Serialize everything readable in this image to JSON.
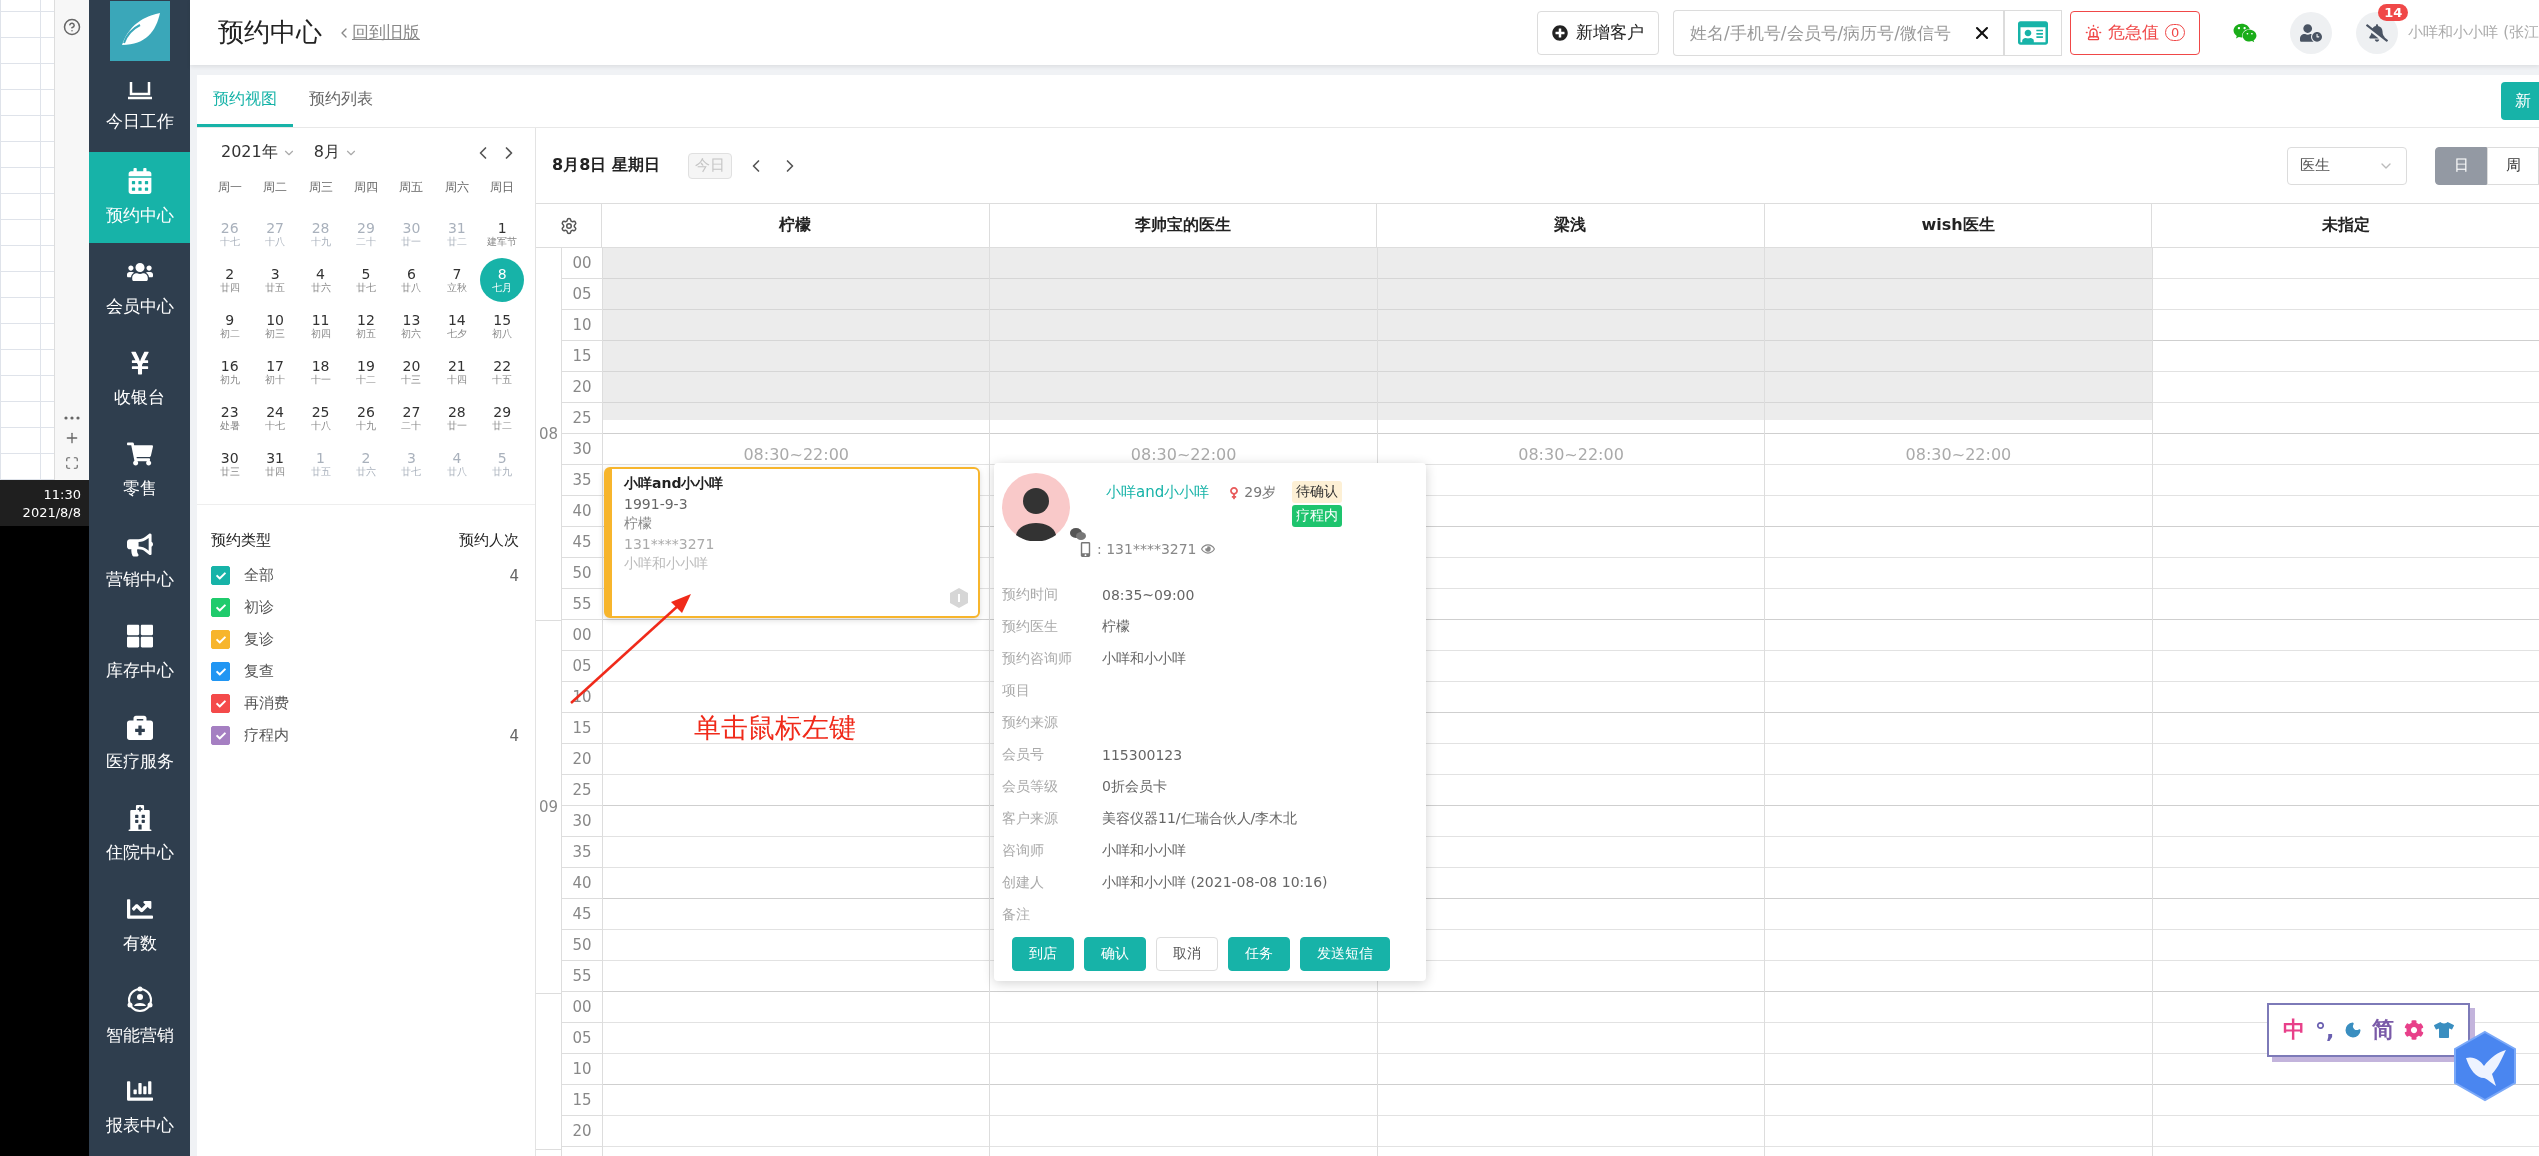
{
  "side_app": {
    "time": "11:30",
    "date": "2021/8/8"
  },
  "nav": {
    "items": [
      {
        "label": "今日工作",
        "selected": false
      },
      {
        "label": "预约中心",
        "selected": true
      },
      {
        "label": "会员中心",
        "selected": false
      },
      {
        "label": "收银台",
        "selected": false
      },
      {
        "label": "零售",
        "selected": false
      },
      {
        "label": "营销中心",
        "selected": false
      },
      {
        "label": "库存中心",
        "selected": false
      },
      {
        "label": "医疗服务",
        "selected": false
      },
      {
        "label": "住院中心",
        "selected": false
      },
      {
        "label": "有数",
        "selected": false
      },
      {
        "label": "智能营销",
        "selected": false
      },
      {
        "label": "报表中心",
        "selected": false
      }
    ]
  },
  "header": {
    "title": "预约中心",
    "back_link": "回到旧版",
    "add_customer": "新增客户",
    "search": {
      "placeholder": "姓名/手机号/会员号/病历号/微信号"
    },
    "alert": {
      "label": "危急值",
      "count": "0"
    },
    "notification_count": "14",
    "user": "小咩和小小咩 (张江"
  },
  "tabs": [
    {
      "label": "预约视图",
      "selected": true
    },
    {
      "label": "预约列表",
      "selected": false
    }
  ],
  "new_button": "新",
  "calendar": {
    "year": "2021年",
    "month": "8月",
    "weekdays": [
      "周一",
      "周二",
      "周三",
      "周四",
      "周五",
      "周六",
      "周日"
    ],
    "days": [
      {
        "day": "26",
        "lunar": "十七",
        "outside": true,
        "selected": false
      },
      {
        "day": "27",
        "lunar": "十八",
        "outside": true,
        "selected": false
      },
      {
        "day": "28",
        "lunar": "十九",
        "outside": true,
        "selected": false
      },
      {
        "day": "29",
        "lunar": "二十",
        "outside": true,
        "selected": false
      },
      {
        "day": "30",
        "lunar": "廿一",
        "outside": true,
        "selected": false
      },
      {
        "day": "31",
        "lunar": "廿二",
        "outside": true,
        "selected": false
      },
      {
        "day": "1",
        "lunar": "建军节",
        "outside": false,
        "selected": false
      },
      {
        "day": "2",
        "lunar": "廿四",
        "outside": false,
        "selected": false
      },
      {
        "day": "3",
        "lunar": "廿五",
        "outside": false,
        "selected": false
      },
      {
        "day": "4",
        "lunar": "廿六",
        "outside": false,
        "selected": false
      },
      {
        "day": "5",
        "lunar": "廿七",
        "outside": false,
        "selected": false
      },
      {
        "day": "6",
        "lunar": "廿八",
        "outside": false,
        "selected": false
      },
      {
        "day": "7",
        "lunar": "立秋",
        "outside": false,
        "selected": false
      },
      {
        "day": "8",
        "lunar": "七月",
        "outside": false,
        "selected": true
      },
      {
        "day": "9",
        "lunar": "初二",
        "outside": false,
        "selected": false
      },
      {
        "day": "10",
        "lunar": "初三",
        "outside": false,
        "selected": false
      },
      {
        "day": "11",
        "lunar": "初四",
        "outside": false,
        "selected": false
      },
      {
        "day": "12",
        "lunar": "初五",
        "outside": false,
        "selected": false
      },
      {
        "day": "13",
        "lunar": "初六",
        "outside": false,
        "selected": false
      },
      {
        "day": "14",
        "lunar": "七夕",
        "outside": false,
        "selected": false
      },
      {
        "day": "15",
        "lunar": "初八",
        "outside": false,
        "selected": false
      },
      {
        "day": "16",
        "lunar": "初九",
        "outside": false,
        "selected": false
      },
      {
        "day": "17",
        "lunar": "初十",
        "outside": false,
        "selected": false
      },
      {
        "day": "18",
        "lunar": "十一",
        "outside": false,
        "selected": false
      },
      {
        "day": "19",
        "lunar": "十二",
        "outside": false,
        "selected": false
      },
      {
        "day": "20",
        "lunar": "十三",
        "outside": false,
        "selected": false
      },
      {
        "day": "21",
        "lunar": "十四",
        "outside": false,
        "selected": false
      },
      {
        "day": "22",
        "lunar": "十五",
        "outside": false,
        "selected": false
      },
      {
        "day": "23",
        "lunar": "处暑",
        "outside": false,
        "selected": false
      },
      {
        "day": "24",
        "lunar": "十七",
        "outside": false,
        "selected": false
      },
      {
        "day": "25",
        "lunar": "十八",
        "outside": false,
        "selected": false
      },
      {
        "day": "26",
        "lunar": "十九",
        "outside": false,
        "selected": false
      },
      {
        "day": "27",
        "lunar": "二十",
        "outside": false,
        "selected": false
      },
      {
        "day": "28",
        "lunar": "廿一",
        "outside": false,
        "selected": false
      },
      {
        "day": "29",
        "lunar": "廿二",
        "outside": false,
        "selected": false
      },
      {
        "day": "30",
        "lunar": "廿三",
        "outside": false,
        "selected": false
      },
      {
        "day": "31",
        "lunar": "廿四",
        "outside": false,
        "selected": false
      },
      {
        "day": "1",
        "lunar": "廿五",
        "outside": true,
        "selected": false
      },
      {
        "day": "2",
        "lunar": "廿六",
        "outside": true,
        "selected": false
      },
      {
        "day": "3",
        "lunar": "廿七",
        "outside": true,
        "selected": false
      },
      {
        "day": "4",
        "lunar": "廿八",
        "outside": true,
        "selected": false
      },
      {
        "day": "5",
        "lunar": "廿九",
        "outside": true,
        "selected": false
      }
    ]
  },
  "types": {
    "title": "预约类型",
    "count_title": "预约人次",
    "items": [
      {
        "label": "全部",
        "color": "#17b3a8",
        "checked": true,
        "count": "4"
      },
      {
        "label": "初诊",
        "color": "#1fcb6c",
        "checked": true
      },
      {
        "label": "复诊",
        "color": "#f7b52c",
        "checked": true
      },
      {
        "label": "复查",
        "color": "#2196f3",
        "checked": true
      },
      {
        "label": "再消费",
        "color": "#f44a4a",
        "checked": true
      },
      {
        "label": "疗程内",
        "color": "#a57fc2",
        "checked": true,
        "count": "4"
      }
    ]
  },
  "schedule": {
    "date": "8月8日 星期日",
    "today": "今日",
    "view_select": "医生",
    "views": [
      {
        "label": "日",
        "selected": true
      },
      {
        "label": "周",
        "selected": false
      }
    ],
    "columns": [
      {
        "name": "柠檬",
        "closed": true,
        "hours": "08:30~22:00"
      },
      {
        "name": "李帅宝的医生",
        "closed": true,
        "hours": "08:30~22:00"
      },
      {
        "name": "梁浅",
        "closed": true,
        "hours": "08:30~22:00"
      },
      {
        "name": "wish医生",
        "closed": true,
        "hours": "08:30~22:00"
      },
      {
        "name": "未指定",
        "closed": false
      }
    ],
    "hours": [
      {
        "hour": "08",
        "minutes": [
          "00",
          "05",
          "10",
          "15",
          "20",
          "25",
          "30",
          "35",
          "40",
          "45",
          "50",
          "55"
        ]
      },
      {
        "hour": "09",
        "minutes": [
          "00",
          "05",
          "10",
          "15",
          "20",
          "25",
          "30",
          "35",
          "40",
          "45",
          "50",
          "55"
        ]
      },
      {
        "minutes": [
          "00",
          "05",
          "10",
          "15",
          "20"
        ]
      }
    ]
  },
  "appointment": {
    "color": "#f7b52c",
    "name": "小咩and小小咩",
    "birthday": "1991-9-3",
    "doctor": "柠檬",
    "phone": "131****3271",
    "consultant": "小咩和小小咩"
  },
  "popup": {
    "name": "小咩and小小咩",
    "age": "29岁",
    "tags": [
      {
        "label": "待确认",
        "kind": "pending"
      },
      {
        "label": "疗程内",
        "kind": "course"
      }
    ],
    "phone": ": 131****3271",
    "fields": [
      {
        "label": "预约时间",
        "value": "08:35~09:00"
      },
      {
        "label": "预约医生",
        "value": "柠檬"
      },
      {
        "label": "预约咨询师",
        "value": "小咩和小小咩"
      },
      {
        "label": "项目"
      },
      {
        "label": "预约来源"
      },
      {
        "label": "会员号",
        "value": "115300123"
      },
      {
        "label": "会员等级",
        "value": "0折会员卡"
      },
      {
        "label": "客户来源",
        "value": "美容仪器11/仁瑞合伙人/李木北"
      },
      {
        "label": "咨询师",
        "value": "小咩和小小咩"
      },
      {
        "label": "创建人",
        "value": "小咩和小小咩 (2021-08-08 10:16)"
      },
      {
        "label": "备注"
      }
    ],
    "actions": [
      {
        "label": "到店",
        "kind": "primary"
      },
      {
        "label": "确认",
        "kind": "primary"
      },
      {
        "label": "取消",
        "kind": "default"
      },
      {
        "label": "任务",
        "kind": "primary"
      },
      {
        "label": "发送短信",
        "kind": "primary"
      }
    ]
  },
  "annotation": "单击鼠标左键",
  "ime": {
    "mode": "中",
    "punctuation": "°,",
    "script": "简"
  }
}
